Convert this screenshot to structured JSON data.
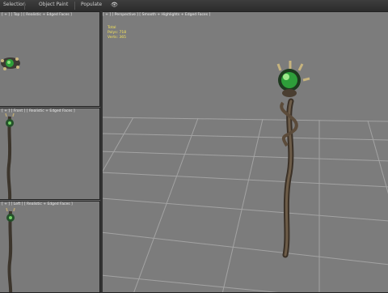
{
  "toolbar": {
    "tabs": [
      "Selection",
      "Object Paint",
      "Populate"
    ],
    "extra_icon": "eye-icon"
  },
  "viewports": {
    "top": {
      "label": "[ + ] [ Top ] [ Realistic + Edged Faces ]"
    },
    "front": {
      "label": "[ + ] [ Front ] [ Realistic + Edged Faces ]"
    },
    "side": {
      "label": "[ + ] [ Left ] [ Realistic + Edged Faces ]"
    },
    "perspective": {
      "label": "[ + ] [ Perspective ] [ Smooth + Highlights + Edged Faces ]",
      "stats": {
        "title": "Total",
        "polys": "Polys: 718",
        "verts": "Verts: 365"
      }
    }
  },
  "colors": {
    "gem": "#2e9e3a",
    "staff": "#5a4a3a",
    "grid": "#9a9a9a"
  }
}
